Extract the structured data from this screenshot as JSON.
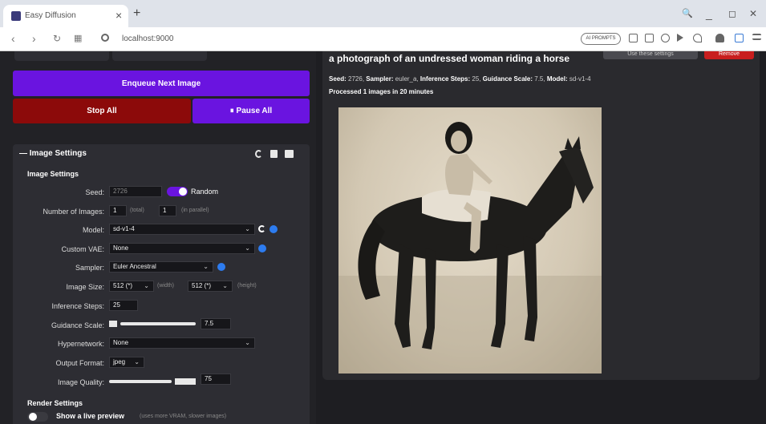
{
  "browser": {
    "tab_title": "Easy Diffusion",
    "tab_close": "×",
    "new_tab": "+",
    "url": "localhost:9000",
    "ai_badge": "AI PROMPTS",
    "win_search": "🔍",
    "win_min": "_",
    "win_max": "◻",
    "win_close": "✕"
  },
  "actions": {
    "enqueue": "Enqueue Next Image",
    "stop_all": "Stop All",
    "pause_all": "⏸ Pause All"
  },
  "settings": {
    "header": "— Image Settings",
    "subheading": "Image Settings",
    "seed_label": "Seed:",
    "seed_value": "2726",
    "random_label": "Random",
    "num_images_label": "Number of Images:",
    "num_images_total": "1",
    "total_hint": "(total)",
    "num_images_parallel": "1",
    "parallel_hint": "(in parallel)",
    "model_label": "Model:",
    "model_value": "sd-v1-4",
    "custom_vae_label": "Custom VAE:",
    "custom_vae_value": "None",
    "sampler_label": "Sampler:",
    "sampler_value": "Euler Ancestral",
    "image_size_label": "Image Size:",
    "width_value": "512 (*)",
    "width_hint": "(width)",
    "height_value": "512 (*)",
    "height_hint": "(height)",
    "inference_label": "Inference Steps:",
    "inference_value": "25",
    "guidance_label": "Guidance Scale:",
    "guidance_value": "7.5",
    "hypernetwork_label": "Hypernetwork:",
    "hypernetwork_value": "None",
    "output_format_label": "Output Format:",
    "output_format_value": "jpeg",
    "image_quality_label": "Image Quality:",
    "image_quality_value": "75",
    "render_heading": "Render Settings",
    "live_preview_label": "Show a live preview",
    "live_preview_hint": "(uses more VRAM, slower images)"
  },
  "result": {
    "prompt": "a photograph of an undressed woman riding a horse",
    "use_settings": "Use these settings",
    "remove": "Remove",
    "seed_key": "Seed:",
    "seed_val": "2726,",
    "sampler_key": "Sampler:",
    "sampler_val": "euler_a,",
    "steps_key": "Inference Steps:",
    "steps_val": "25,",
    "guidance_key": "Guidance Scale:",
    "guidance_val": "7.5,",
    "model_key": "Model:",
    "model_val": "sd-v1-4",
    "processed": "Processed 1 images in 20 minutes"
  },
  "colors": {
    "accent_purple": "#6a14e0",
    "stop_red": "#8c0a0a",
    "remove_red": "#c81e1e",
    "info_blue": "#2d7cf0"
  }
}
